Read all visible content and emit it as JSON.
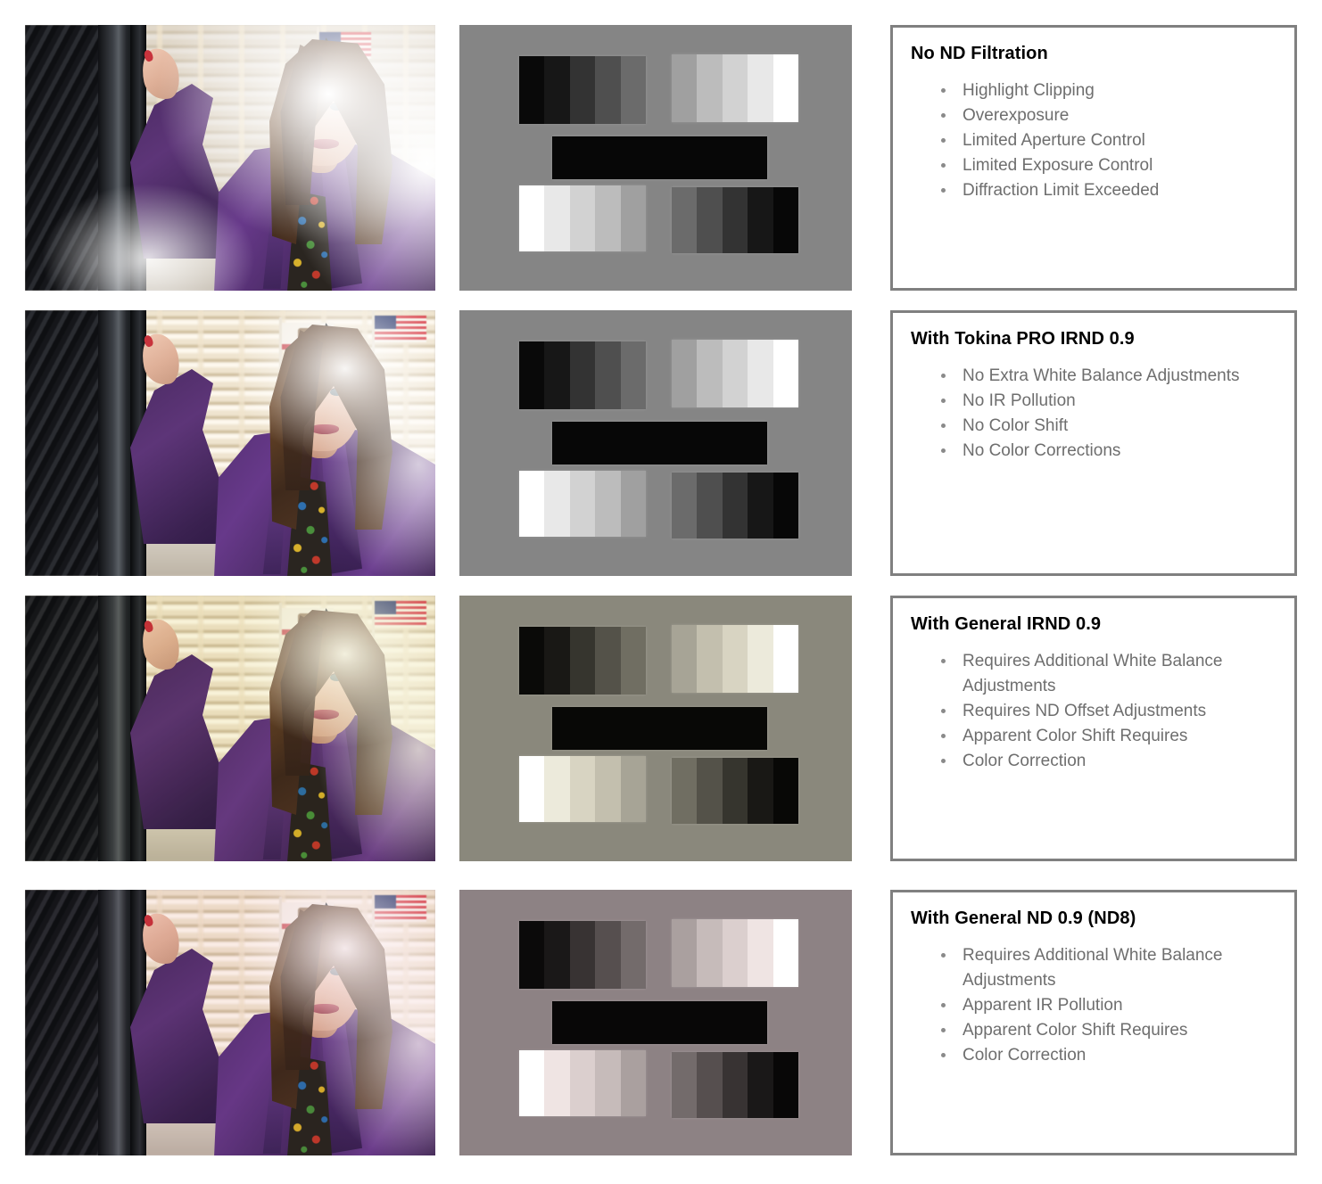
{
  "document": {
    "title": "ND Filtration Comparison Chart",
    "layout": "4 rows x 3 columns: sample photo, grayscale test chart, description panel",
    "background": "#ffffff"
  },
  "styles": {
    "panel_border_color": "#808080",
    "heading_color": "#000000",
    "bullet_text_color": "#6e6e6e",
    "bullet_marker_color": "#8a8a8a"
  },
  "rows": [
    {
      "id": "row-no-nd",
      "photo": {
        "alt_name": "sample-photo-no-nd",
        "description": "Woman in purple leather jacket leaning on dark post, blown-out overexposed background",
        "cast_overlay": "rgba(255,255,255,0)",
        "exposure": "overexposed"
      },
      "chart": {
        "alt_name": "grayscale-chart-no-nd",
        "background_color": "#858585",
        "top_left_steps": [
          "#090909",
          "#171717",
          "#333333",
          "#4f4f4f",
          "#6b6b6b"
        ],
        "top_right_steps": [
          "#a0a0a0",
          "#bcbcbc",
          "#d2d2d2",
          "#e8e8e8",
          "#ffffff"
        ],
        "middle_bar": "#070707",
        "bottom_left_steps": [
          "#ffffff",
          "#e8e8e8",
          "#d2d2d2",
          "#bcbcbc",
          "#a0a0a0"
        ],
        "bottom_right_steps": [
          "#6b6b6b",
          "#4f4f4f",
          "#333333",
          "#171717",
          "#070707"
        ]
      },
      "panel": {
        "heading": "No ND Filtration",
        "bullets": [
          "Highlight Clipping",
          "Overexposure",
          "Limited Aperture Control",
          "Limited Exposure Control",
          "Diffraction Limit Exceeded"
        ]
      }
    },
    {
      "id": "row-tokina-pro-irnd",
      "photo": {
        "alt_name": "sample-photo-tokina-pro-irnd",
        "description": "Same scene, correctly exposed with neutral color, flags and building detail visible",
        "cast_overlay": "rgba(255,255,255,0)",
        "exposure": "correct"
      },
      "chart": {
        "alt_name": "grayscale-chart-tokina-pro-irnd",
        "background_color": "#858585",
        "top_left_steps": [
          "#090909",
          "#171717",
          "#333333",
          "#4f4f4f",
          "#6b6b6b"
        ],
        "top_right_steps": [
          "#a0a0a0",
          "#bcbcbc",
          "#d2d2d2",
          "#e8e8e8",
          "#ffffff"
        ],
        "middle_bar": "#070707",
        "bottom_left_steps": [
          "#ffffff",
          "#e8e8e8",
          "#d2d2d2",
          "#bcbcbc",
          "#a0a0a0"
        ],
        "bottom_right_steps": [
          "#6b6b6b",
          "#4f4f4f",
          "#333333",
          "#171717",
          "#070707"
        ]
      },
      "panel": {
        "heading": "With Tokina PRO IRND 0.9",
        "bullets": [
          "No Extra White Balance Adjustments",
          "No IR Pollution",
          "No Color Shift",
          "No Color Corrections"
        ]
      }
    },
    {
      "id": "row-general-irnd",
      "photo": {
        "alt_name": "sample-photo-general-irnd",
        "description": "Same scene with a warm greenish-olive color shift",
        "cast_overlay": "rgba(246,244,214,0.55)",
        "exposure": "correct"
      },
      "chart": {
        "alt_name": "grayscale-chart-general-irnd",
        "background_color": "#8a887c",
        "top_left_steps": [
          "#0a0a08",
          "#191815",
          "#36352e",
          "#545249",
          "#706e62"
        ],
        "top_right_steps": [
          "#a7a496",
          "#c3bfae",
          "#d8d4c2",
          "#eceadb",
          "#ffffff"
        ],
        "middle_bar": "#080806",
        "bottom_left_steps": [
          "#ffffff",
          "#eceadb",
          "#d8d4c2",
          "#c3bfae",
          "#a7a496"
        ],
        "bottom_right_steps": [
          "#706e62",
          "#545249",
          "#36352e",
          "#191815",
          "#080806"
        ]
      },
      "panel": {
        "heading": "With General IRND 0.9",
        "bullets": [
          "Requires Additional White Balance Adjustments",
          "Requires ND Offset Adjustments",
          "Apparent Color Shift Requires",
          "Color Correction"
        ]
      }
    },
    {
      "id": "row-general-nd8",
      "photo": {
        "alt_name": "sample-photo-general-nd-8",
        "description": "Same scene with a magenta / warm infrared pollution color shift",
        "cast_overlay": "rgba(250,232,238,0.50)",
        "exposure": "correct"
      },
      "chart": {
        "alt_name": "grayscale-chart-general-nd-8",
        "background_color": "#8d8284",
        "top_left_steps": [
          "#0b0a0a",
          "#1a1818",
          "#383333",
          "#564f4f",
          "#736b6b"
        ],
        "top_right_steps": [
          "#aaa09f",
          "#c6bbba",
          "#dbcfce",
          "#efe4e3",
          "#ffffff"
        ],
        "middle_bar": "#080707",
        "bottom_left_steps": [
          "#ffffff",
          "#efe4e3",
          "#dbcfce",
          "#c6bbba",
          "#aaa09f"
        ],
        "bottom_right_steps": [
          "#736b6b",
          "#564f4f",
          "#383333",
          "#1a1818",
          "#080707"
        ]
      },
      "panel": {
        "heading": "With General ND 0.9 (ND8)",
        "bullets": [
          "Requires Additional White Balance Adjustments",
          "Apparent IR Pollution",
          "Apparent Color Shift Requires",
          "Color Correction"
        ]
      }
    }
  ]
}
